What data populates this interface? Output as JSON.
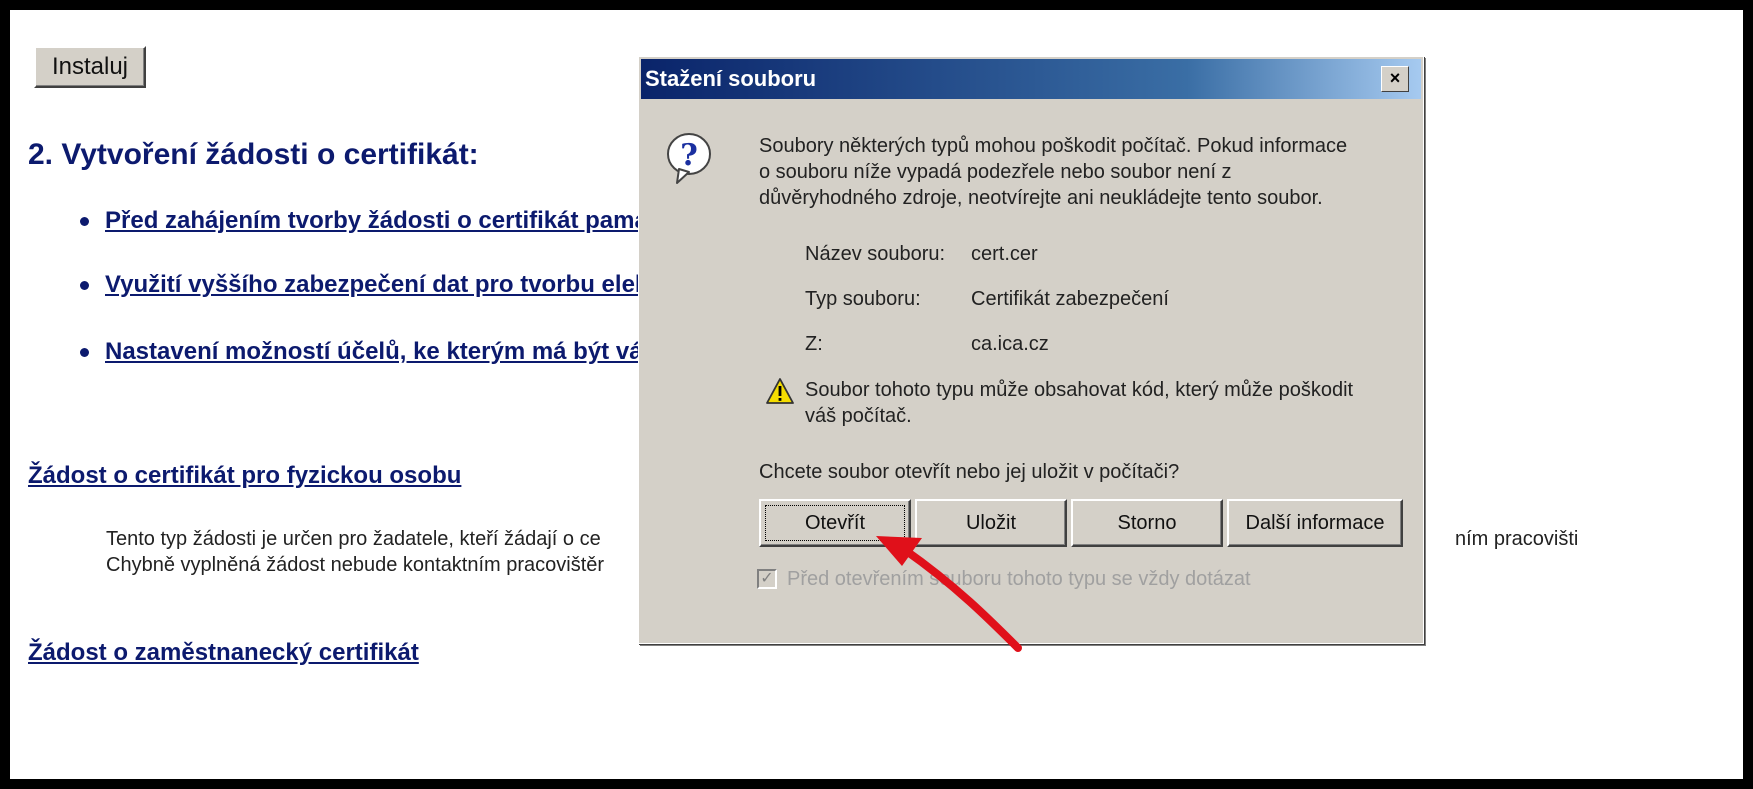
{
  "page": {
    "install_button": "Instaluj",
    "section_heading": "2. Vytvoření žádosti o certifikát:",
    "bullets": [
      "Před zahájením tvorby žádosti o certifikát pama",
      "Využití vyššího zabezpečení dat pro tvorbu elek",
      "Nastavení možností účelů, ke kterým má být vá"
    ],
    "link_personal": "Žádost o certifikát pro fyzickou osobu",
    "para_line1": "Tento typ žádosti je určen pro žadatele, kteří žádají o ce",
    "para_line2": "Chybně vyplněná žádost nebude kontaktním pracovištěr",
    "para_right_fragment": "ním pracovišti",
    "link_employee": "Žádost o zaměstnanecký certifikát"
  },
  "dialog": {
    "title": "Stažení souboru",
    "close_label": "×",
    "intro_lines": [
      "Soubory některých typů mohou poškodit počítač. Pokud informace",
      "o souboru níže vypadá podezřele nebo soubor není z",
      "důvěryhodného zdroje, neotvírejte ani neukládejte tento soubor."
    ],
    "fields": [
      {
        "label": "Název souboru:",
        "value": "cert.cer"
      },
      {
        "label": "Typ souboru:",
        "value": "Certifikát zabezpečení"
      },
      {
        "label": "Z:",
        "value": "ca.ica.cz"
      }
    ],
    "warning_lines": [
      "Soubor tohoto typu může obsahovat kód, který může poškodit",
      "váš počítač."
    ],
    "question": "Chcete soubor otevřít nebo jej uložit v počítači?",
    "buttons": {
      "open": "Otevřít",
      "save": "Uložit",
      "cancel": "Storno",
      "more_info": "Další informace"
    },
    "checkbox_label": "Před otevřením souboru tohoto typu se vždy dotázat",
    "checkbox_checked": true
  },
  "colors": {
    "link": "#0c1a6e",
    "titlebar": "#0a246a",
    "dialog_bg": "#d4d0c8",
    "annotation_arrow": "#e0101a"
  },
  "icons": {
    "question": "question-icon",
    "warning": "warning-icon",
    "arrow": "red-arrow-annotation"
  }
}
